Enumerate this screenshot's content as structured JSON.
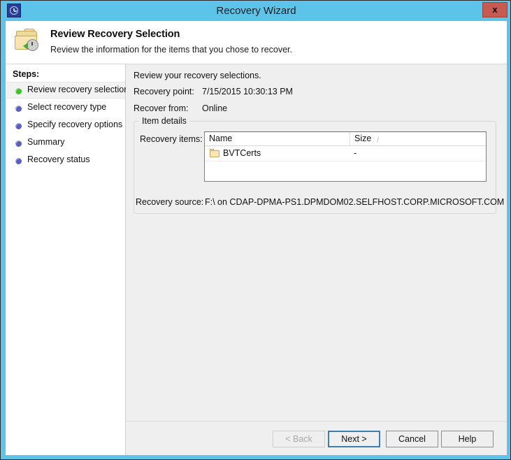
{
  "window": {
    "title": "Recovery Wizard",
    "app_icon": "clock-recovery-icon",
    "close_label": "x",
    "border_color": "#5bc4e8"
  },
  "header": {
    "icon": "folder-recovery-icon",
    "title": "Review Recovery Selection",
    "subtitle": "Review the information for the items that you chose to recover."
  },
  "sidebar": {
    "heading": "Steps:",
    "items": [
      {
        "label": "Review recovery selection",
        "state": "active",
        "bullet_color": "#3fc12a"
      },
      {
        "label": "Select recovery type",
        "state": "pending",
        "bullet_color": "#5a5fc0"
      },
      {
        "label": "Specify recovery options",
        "state": "pending",
        "bullet_color": "#5a5fc0"
      },
      {
        "label": "Summary",
        "state": "pending",
        "bullet_color": "#5a5fc0"
      },
      {
        "label": "Recovery status",
        "state": "pending",
        "bullet_color": "#5a5fc0"
      }
    ]
  },
  "content": {
    "intro": "Review your recovery selections.",
    "fields": [
      {
        "label": "Recovery point:",
        "value": "7/15/2015 10:30:13 PM"
      },
      {
        "label": "Recover from:",
        "value": "Online"
      }
    ],
    "group": {
      "legend": "Item details",
      "recovery_items_label": "Recovery items:",
      "listview": {
        "columns": [
          {
            "label": "Name",
            "sort_indicator": ""
          },
          {
            "label": "Size",
            "sort_indicator": "/"
          }
        ],
        "rows": [
          {
            "icon": "folder-icon",
            "name": "BVTCerts",
            "size": "-"
          }
        ]
      },
      "recovery_source_label": "Recovery source:",
      "recovery_source_value": "F:\\ on CDAP-DPMA-PS1.DPMDOM02.SELFHOST.CORP.MICROSOFT.COM"
    }
  },
  "footer": {
    "buttons": [
      {
        "label": "< Back",
        "state": "disabled"
      },
      {
        "label": "Next >",
        "state": "default"
      },
      {
        "label": "Cancel",
        "state": "normal"
      },
      {
        "label": "Help",
        "state": "normal"
      }
    ]
  }
}
